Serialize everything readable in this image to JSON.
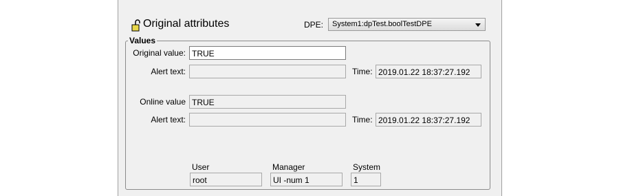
{
  "header": {
    "title": "Original attributes",
    "dpe_label": "DPE:",
    "dpe_value": "System1:dpTest.boolTestDPE"
  },
  "values_group": {
    "label": "Values",
    "original_value_label": "Original value:",
    "original_value": "TRUE",
    "alert_text_label": "Alert text:",
    "alert_text_1": "",
    "time_label": "Time:",
    "time_1": "2019.01.22 18:37:27.192",
    "online_value_label": "Online value",
    "online_value": "TRUE",
    "alert_text_2": "",
    "time_2": "2019.01.22 18:37:27.192"
  },
  "footer": {
    "user_label": "User",
    "user_value": "root",
    "manager_label": "Manager",
    "manager_value": "UI -num 1",
    "system_label": "System",
    "system_value": "1"
  }
}
